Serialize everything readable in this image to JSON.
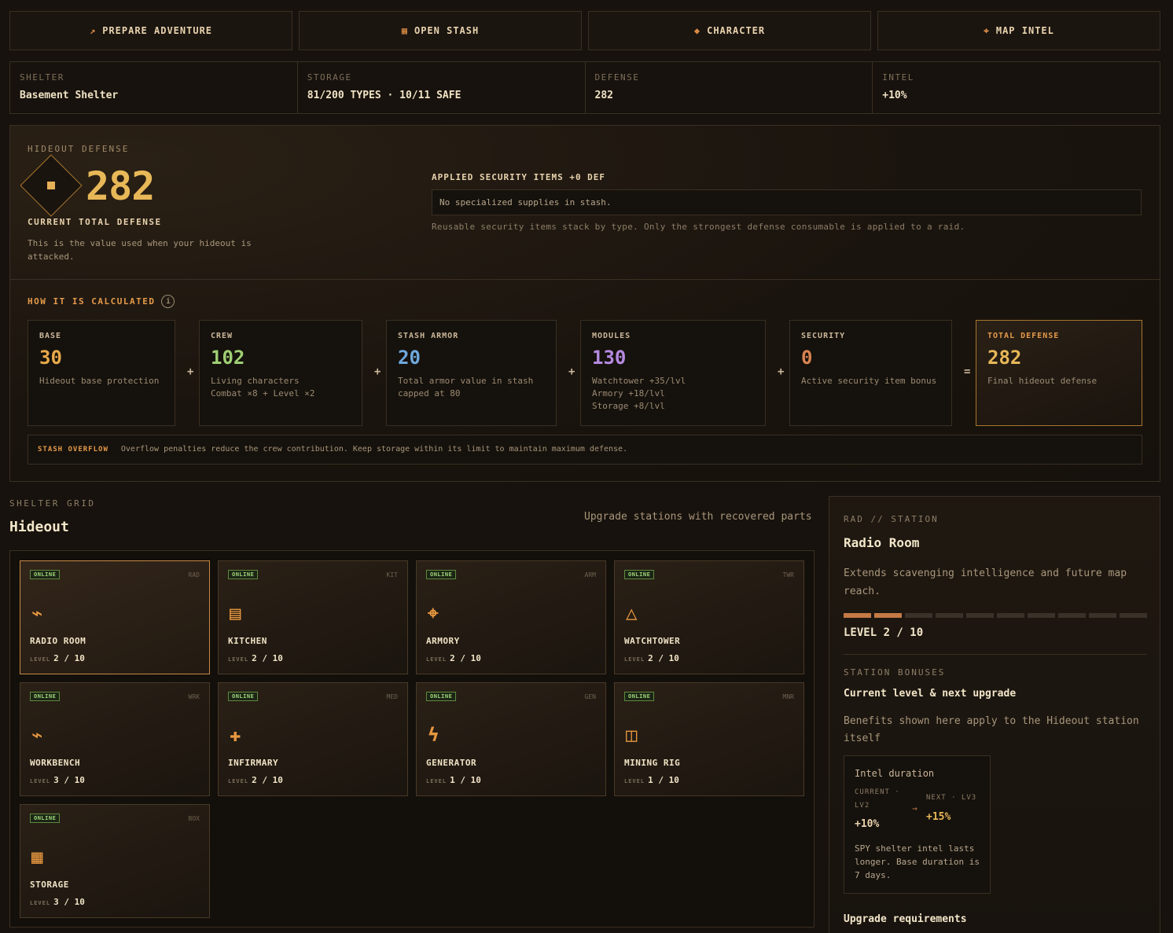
{
  "nav": [
    {
      "label": "PREPARE ADVENTURE",
      "icon": "↗"
    },
    {
      "label": "OPEN STASH",
      "icon": "▦"
    },
    {
      "label": "CHARACTER",
      "icon": "◆"
    },
    {
      "label": "MAP INTEL",
      "icon": "⌖"
    }
  ],
  "info": [
    {
      "label": "SHELTER",
      "value": "Basement Shelter"
    },
    {
      "label": "STORAGE",
      "value": "81/200 TYPES · 10/11 SAFE"
    },
    {
      "label": "DEFENSE",
      "value": "282"
    },
    {
      "label": "INTEL",
      "value": "+10%"
    }
  ],
  "defense": {
    "section_label": "HIDEOUT DEFENSE",
    "value": "282",
    "current_label": "CURRENT TOTAL DEFENSE",
    "description": "This is the value used when your hideout is attacked.",
    "applied_title": "APPLIED SECURITY ITEMS +0 DEF",
    "applied_box": "No specialized supplies in stash.",
    "applied_note": "Reusable security items stack by type. Only the strongest defense consumable is applied to a raid.",
    "calc_title": "HOW IT IS CALCULATED",
    "info_glyph": "i",
    "calc": [
      {
        "label": "BASE",
        "value": "30",
        "desc": "Hideout base protection",
        "color": "#e8a94a"
      },
      {
        "label": "CREW",
        "value": "102",
        "desc": "Living characters\nCombat ×8 + Level ×2",
        "color": "#9fcf74"
      },
      {
        "label": "STASH ARMOR",
        "value": "20",
        "desc": "Total armor value in stash\ncapped at 80",
        "color": "#6fa8dc"
      },
      {
        "label": "MODULES",
        "value": "130",
        "desc": "Watchtower +35/lvl\nArmory +18/lvl\nStorage +8/lvl",
        "color": "#b58ae0"
      },
      {
        "label": "SECURITY",
        "value": "0",
        "desc": "Active security item bonus",
        "color": "#d98350"
      },
      {
        "label": "TOTAL DEFENSE",
        "value": "282",
        "desc": "Final hideout defense",
        "color": "#e8b858"
      }
    ],
    "ops": [
      "+",
      "+",
      "+",
      "+",
      "="
    ],
    "overflow_tag": "STASH OVERFLOW",
    "overflow_text": "Overflow penalties reduce the crew contribution. Keep storage within its limit to maintain maximum defense."
  },
  "grid": {
    "section_label": "SHELTER GRID",
    "title": "Hideout",
    "subtitle": "Upgrade stations with recovered parts",
    "level_label": "LEVEL",
    "stations": [
      {
        "name": "RADIO ROOM",
        "code": "RAD",
        "status": "ONLINE",
        "level": "2 / 10",
        "icon": "⌁"
      },
      {
        "name": "KITCHEN",
        "code": "KIT",
        "status": "ONLINE",
        "level": "2 / 10",
        "icon": "▤"
      },
      {
        "name": "ARMORY",
        "code": "ARM",
        "status": "ONLINE",
        "level": "2 / 10",
        "icon": "⌖"
      },
      {
        "name": "WATCHTOWER",
        "code": "TWR",
        "status": "ONLINE",
        "level": "2 / 10",
        "icon": "△"
      },
      {
        "name": "WORKBENCH",
        "code": "WRK",
        "status": "ONLINE",
        "level": "3 / 10",
        "icon": "⌁"
      },
      {
        "name": "INFIRMARY",
        "code": "MED",
        "status": "ONLINE",
        "level": "2 / 10",
        "icon": "✚"
      },
      {
        "name": "GENERATOR",
        "code": "GEN",
        "status": "ONLINE",
        "level": "1 / 10",
        "icon": "ϟ"
      },
      {
        "name": "MINING RIG",
        "code": "MNR",
        "status": "ONLINE",
        "level": "1 / 10",
        "icon": "◫"
      },
      {
        "name": "STORAGE",
        "code": "BOX",
        "status": "ONLINE",
        "level": "3 / 10",
        "icon": "▦"
      }
    ]
  },
  "detail": {
    "tag": "RAD // STATION",
    "title": "Radio Room",
    "desc": "Extends scavenging intelligence and future map reach.",
    "level_filled": 2,
    "level_total": 10,
    "level_text": "LEVEL 2 / 10",
    "bonus_label": "STATION BONUSES",
    "bonus_title": "Current level & next upgrade",
    "bonus_desc": "Benefits shown here apply to the Hideout station itself",
    "bonus": {
      "name": "Intel duration",
      "current_label": "CURRENT ·",
      "current_level": "LV2",
      "current_value": "+10%",
      "arrow": "→",
      "next_label": "NEXT · LV3",
      "next_value": "+15%",
      "note": "SPY shelter intel lasts longer. Base duration is 7 days."
    },
    "upgrade_title": "Upgrade requirements"
  }
}
